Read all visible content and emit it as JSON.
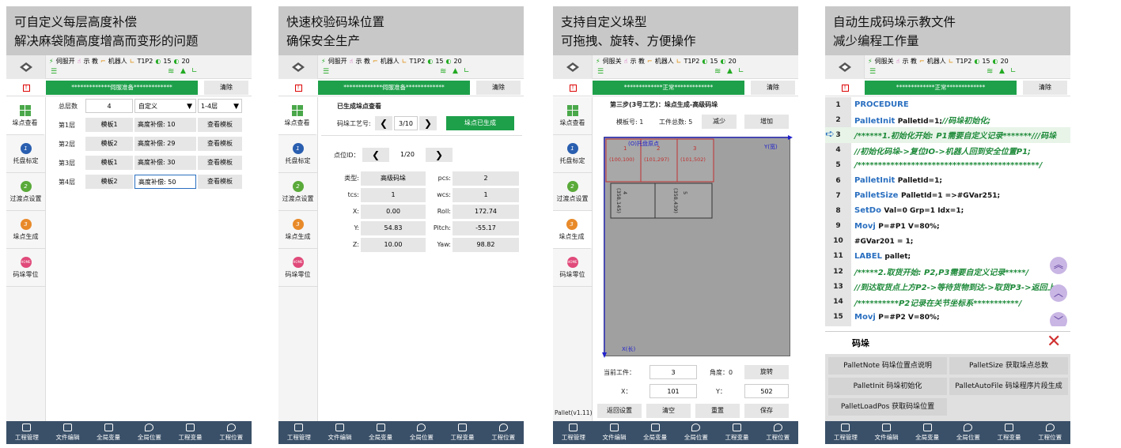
{
  "status": {
    "servo1": "伺服开",
    "servo2": "伺服关",
    "teach": "示 教",
    "robot": "机器人",
    "tool": "T1P2",
    "count_a": "15",
    "count_b": "20",
    "clear": "清除",
    "msg_servo": "*************伺服准备*************",
    "msg_ok": "*************正常*************"
  },
  "colors": {
    "accent_green": "#1ea04a",
    "nav_dark": "#3a5068",
    "blue": "#2222cc"
  },
  "nav": {
    "items": [
      {
        "label": "垛点查看",
        "icon": "grid-icon"
      },
      {
        "label": "托盘标定",
        "icon": "number-1-icon",
        "num": "1"
      },
      {
        "label": "过渡点设置",
        "icon": "number-2-icon",
        "num": "2"
      },
      {
        "label": "垛点生成",
        "icon": "number-3-icon",
        "num": "3"
      },
      {
        "label": "码垛零位",
        "icon": "home-icon",
        "num": "HOME"
      }
    ],
    "version": "Pallet(v1.11)"
  },
  "tabs": [
    "工程管理",
    "文件编辑",
    "全局变量",
    "全局位置",
    "工程变量",
    "工程位置"
  ],
  "panel1": {
    "caption1": "可自定义每层高度补偿",
    "caption2": "解决麻袋随高度增高而变形的问题",
    "total_label": "总层数",
    "total_value": "4",
    "mode": "自定义",
    "range": "1-4层",
    "layers": [
      {
        "name": "第1层",
        "template": "模板1",
        "comp": "高度补偿: 10",
        "btn": "查看模板"
      },
      {
        "name": "第2层",
        "template": "模板2",
        "comp": "高度补偿: 29",
        "btn": "查看模板"
      },
      {
        "name": "第3层",
        "template": "模板1",
        "comp": "高度补偿: 30",
        "btn": "查看模板"
      },
      {
        "name": "第4层",
        "template": "模板2",
        "comp": "高度补偿: 50",
        "btn": "查看模板"
      }
    ]
  },
  "panel2": {
    "caption1": "快速校验码垛位置",
    "caption2": "确保安全生产",
    "title": "已生成垛点查看",
    "craft_label": "码垛工艺号:",
    "craft_value": "3/10",
    "generated": "垛点已生成",
    "point_label": "点位ID：",
    "point_value": "1/20",
    "fields": [
      [
        "类型:",
        "高级码垛",
        "pcs:",
        "2"
      ],
      [
        "tcs:",
        "1",
        "wcs:",
        "1"
      ],
      [
        "X:",
        "0.00",
        "Roll:",
        "172.74"
      ],
      [
        "Y:",
        "54.83",
        "Pitch:",
        "-55.17"
      ],
      [
        "Z:",
        "10.00",
        "Yaw:",
        "98.82"
      ]
    ]
  },
  "panel3": {
    "caption1": "支持自定义垛型",
    "caption2": "可拖拽、旋转、方便操作",
    "title": "第三步(3号工艺)：垛点生成-高级码垛",
    "template_label": "模板号: 1",
    "total_label": "工件总数: 5",
    "reduce": "减少",
    "add": "增加",
    "origin_label": "(O)托盘原点",
    "y_axis": "Y(宽)",
    "x_axis": "X(长)",
    "boxes": [
      {
        "id": "1",
        "coord": "(100,100)"
      },
      {
        "id": "2",
        "coord": "(101,297)"
      },
      {
        "id": "3",
        "coord": "(101,502)"
      },
      {
        "id": "4",
        "coord": "(358,145)"
      },
      {
        "id": "5",
        "coord": "(358,439)"
      }
    ],
    "current_label": "当前工件：",
    "current_value": "3",
    "angle_label": "角度：0",
    "rotate": "旋转",
    "x_label": "X：",
    "x_value": "101",
    "y_label": "Y：",
    "y_value": "502",
    "back": "返回设置",
    "clear": "清空",
    "reset": "重置",
    "save": "保存"
  },
  "panel4": {
    "caption1": "自动生成码垛示教文件",
    "caption2": "减少编程工作量",
    "code": [
      {
        "n": "1",
        "parts": [
          [
            "kw",
            "PROCEDURE"
          ]
        ]
      },
      {
        "n": "2",
        "parts": [
          [
            "kw",
            "PalletInit "
          ],
          [
            "pl",
            "PalletId=1;"
          ],
          [
            "cm",
            "//码垛初始化;"
          ]
        ]
      },
      {
        "n": "3",
        "parts": [
          [
            "cm",
            "/******1.初始化开始: P1需要自定义记录*******///码垛"
          ]
        ]
      },
      {
        "n": "4",
        "parts": [
          [
            "cm",
            "//初始化码垛->复位IO->机器人回到安全位置P1;"
          ]
        ]
      },
      {
        "n": "5",
        "parts": [
          [
            "cm",
            "/********************************************/"
          ]
        ]
      },
      {
        "n": "6",
        "parts": [
          [
            "kw",
            "PalletInit "
          ],
          [
            "pl",
            "PalletId=1;"
          ]
        ]
      },
      {
        "n": "7",
        "parts": [
          [
            "kw",
            "PalletSize "
          ],
          [
            "pl",
            "PalletId=1 =>#GVar251;"
          ]
        ]
      },
      {
        "n": "8",
        "parts": [
          [
            "kw",
            "SetDo "
          ],
          [
            "pl",
            "Val=0 Grp=1 Idx=1;"
          ]
        ]
      },
      {
        "n": "9",
        "parts": [
          [
            "kw",
            "Movj "
          ],
          [
            "pl",
            "P=#P1 V=80%;"
          ]
        ]
      },
      {
        "n": "10",
        "parts": [
          [
            "pl",
            "#GVar201 = 1;"
          ]
        ]
      },
      {
        "n": "11",
        "parts": [
          [
            "kw",
            "LABEL "
          ],
          [
            "pl",
            "pallet;"
          ]
        ]
      },
      {
        "n": "12",
        "parts": [
          [
            "cm",
            "/*****2.取货开始: P2,P3需要自定义记录*****/"
          ]
        ]
      },
      {
        "n": "13",
        "parts": [
          [
            "cm",
            "//到达取货点上方P2->等待货物到达->取货P3->返回上"
          ]
        ]
      },
      {
        "n": "14",
        "parts": [
          [
            "cm",
            "/**********P2记录在关节坐标系***********/"
          ]
        ]
      },
      {
        "n": "15",
        "parts": [
          [
            "kw",
            "Movj "
          ],
          [
            "pl",
            "P=#P2 V=80%;"
          ]
        ]
      }
    ],
    "menu_title": "码垛",
    "cmds": [
      "PalletNote 码垛位置点说明",
      "PalletSize 获取垛点总数",
      "PalletInit 码垛初始化",
      "PalletAutoFile 码垛程序片段生成",
      "PalletLoadPos 获取码垛位置"
    ]
  }
}
